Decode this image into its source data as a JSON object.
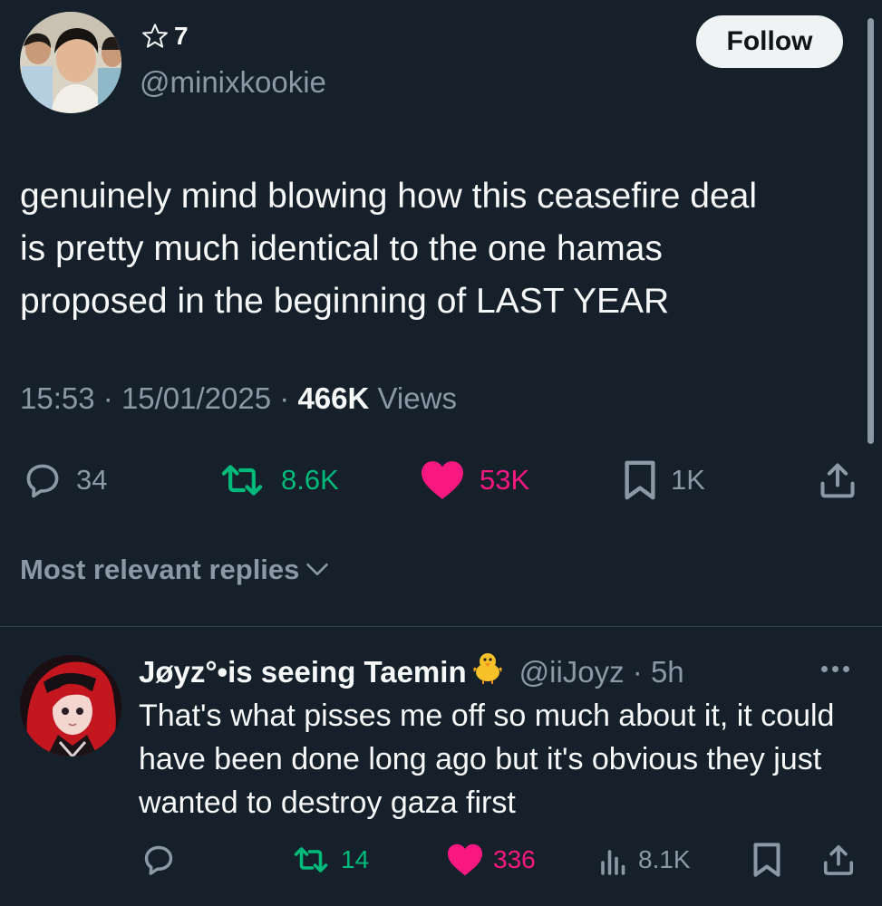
{
  "tweet": {
    "author": {
      "display_name": "7",
      "handle": "@minixkookie"
    },
    "follow_label": "Follow",
    "text": "genuinely mind blowing how this ceasefire deal\nis pretty much identical to the one hamas\nproposed in the beginning of LAST YEAR",
    "time": "15:53",
    "date": "15/01/2025",
    "views_count": "466K",
    "views_label": "Views",
    "stats": {
      "replies": "34",
      "reposts": "8.6K",
      "likes": "53K",
      "bookmarks": "1K"
    }
  },
  "replies_sort_label": "Most relevant replies",
  "reply": {
    "display_name": "Jøyz°•is seeing Taemin",
    "handle": "@iiJoyz",
    "time": "5h",
    "text": "That's what pisses me off so much about it, it could have been done long ago but it's obvious they just wanted to destroy gaza first",
    "stats": {
      "reposts": "14",
      "likes": "336",
      "views": "8.1K"
    }
  },
  "colors": {
    "background": "#15202b",
    "text_primary": "#f7f9f9",
    "text_secondary": "#8b98a5",
    "repost_green": "#00ba7c",
    "like_pink": "#f91880",
    "divider": "#38444d"
  },
  "icons": [
    "star-icon",
    "reply-icon",
    "repost-icon",
    "heart-icon",
    "bookmark-icon",
    "share-icon",
    "chevron-down-icon",
    "chick-emoji-icon",
    "more-icon",
    "views-icon"
  ]
}
